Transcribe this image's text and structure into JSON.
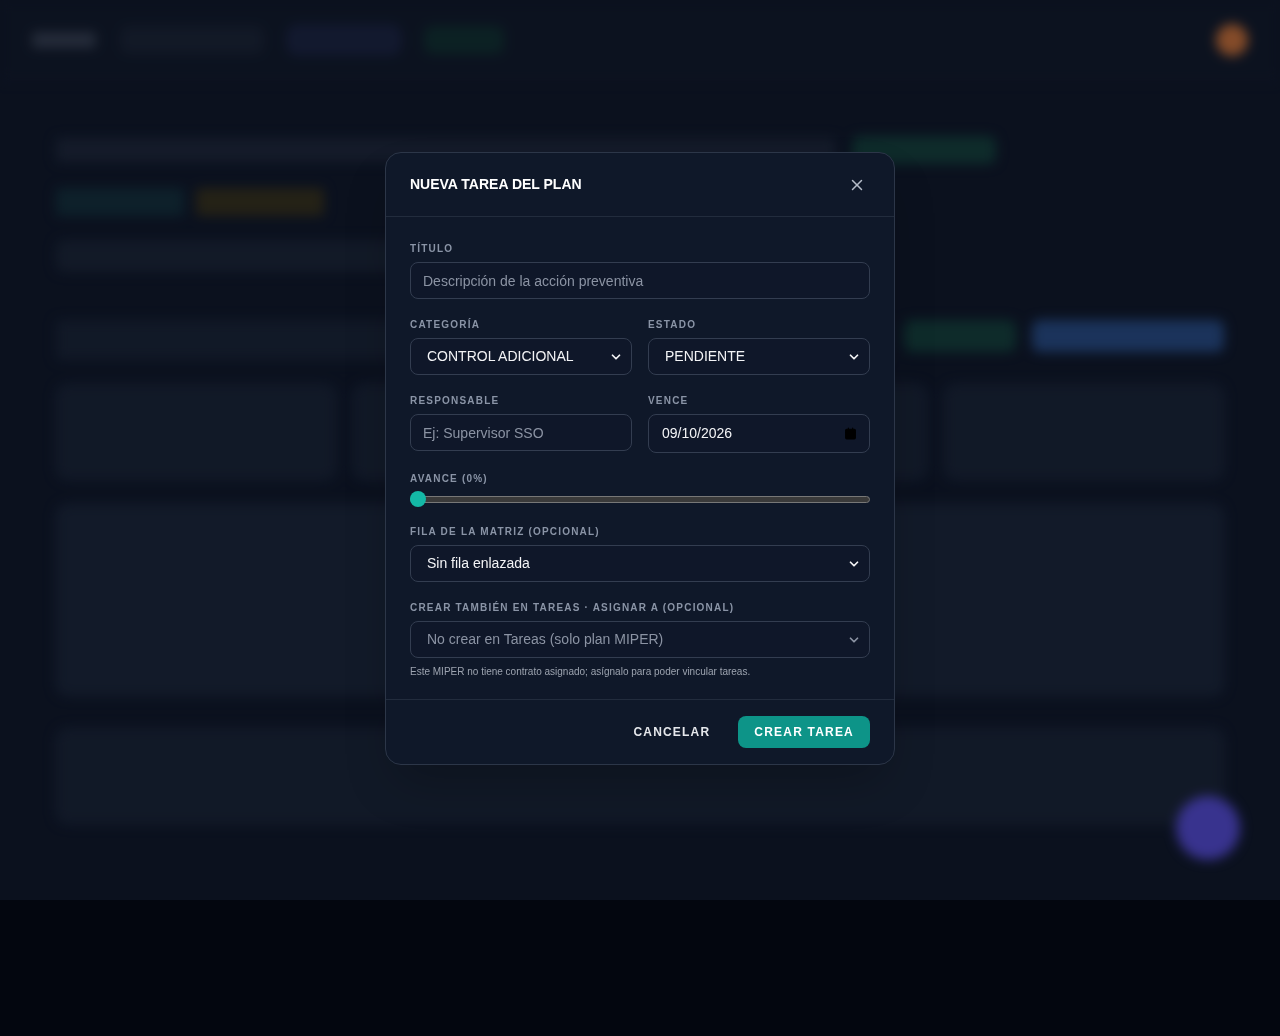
{
  "dialog": {
    "title": "NUEVA TAREA DEL PLAN",
    "fields": [
      {
        "kind": "text",
        "label": "TÍTULO",
        "placeholder": "Descripción de la acción preventiva"
      },
      {
        "kind": "select",
        "label": "CATEGORÍA",
        "value": "CONTROL ADICIONAL",
        "half": true
      },
      {
        "kind": "select",
        "label": "ESTADO",
        "value": "PENDIENTE",
        "half": true
      },
      {
        "kind": "text",
        "label": "RESPONSABLE",
        "placeholder": "Ej: Supervisor SSO",
        "half": true
      },
      {
        "kind": "date",
        "label": "VENCE",
        "value": "09/10/2026",
        "half": true
      },
      {
        "kind": "slider",
        "label": "AVANCE (0%)",
        "level": 0
      },
      {
        "kind": "select",
        "label": "FILA DE LA MATRIZ (OPCIONAL)",
        "value": "Sin fila enlazada"
      },
      {
        "kind": "select",
        "label": "CREAR TAMBIÉN EN TAREAS · ASIGNAR A (OPCIONAL)",
        "value": "No crear en Tareas (solo plan MIPER)",
        "disabled": true,
        "hint": "Este MIPER no tiene contrato asignado; asígnalo para poder vincular tareas."
      }
    ],
    "buttons": [
      {
        "label": "CANCELAR",
        "kind": "secondary"
      },
      {
        "label": "CREAR TAREA",
        "kind": "primary"
      }
    ]
  }
}
